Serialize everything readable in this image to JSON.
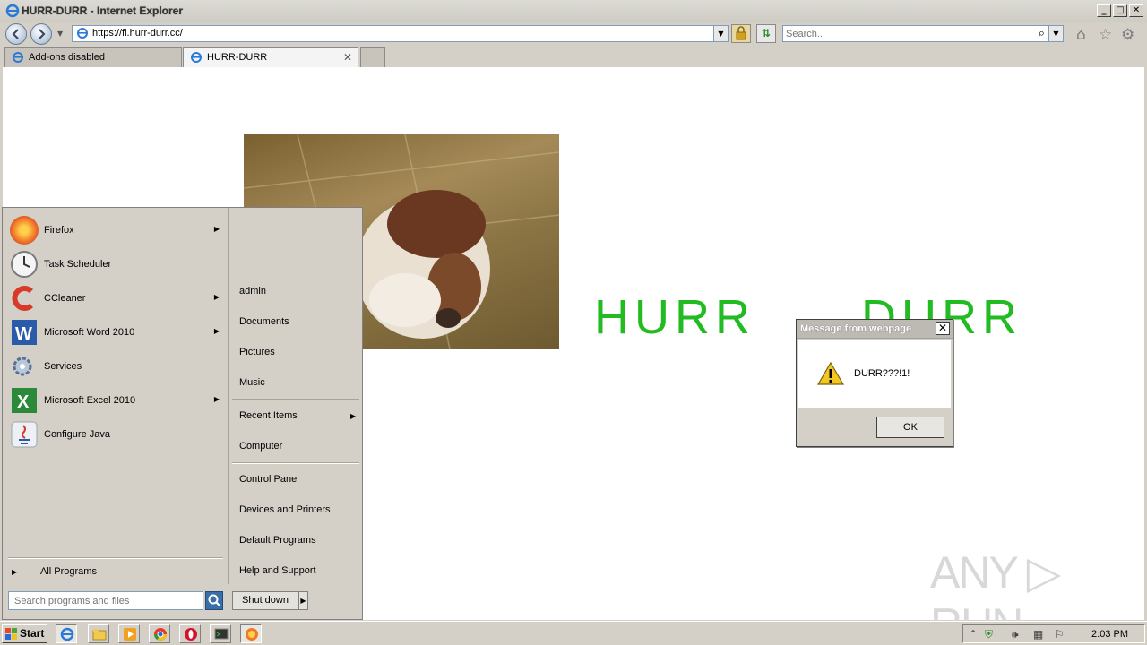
{
  "window": {
    "title": "HURR-DURR - Internet Explorer",
    "min_glyph": "_",
    "max_glyph": "□",
    "close_glyph": "✕"
  },
  "navbar": {
    "url": "https://fl.hurr-durr.cc/",
    "search_placeholder": "Search..."
  },
  "tabs": [
    {
      "label": "Add-ons disabled",
      "active": false
    },
    {
      "label": "HURR-DURR",
      "active": true,
      "close_glyph": "✕"
    }
  ],
  "page": {
    "hurr_text": "HURR",
    "durr_text": "DURR",
    "watermark": "ANY ▷ RUN"
  },
  "dialog": {
    "title": "Message from webpage",
    "message": "DURR???!1!",
    "ok_label": "OK",
    "close_glyph": "✕"
  },
  "start_menu": {
    "programs": [
      {
        "label": "Firefox",
        "icon": "firefox-icon",
        "has_submenu": true,
        "color": "#e8582a"
      },
      {
        "label": "Task Scheduler",
        "icon": "clock-icon",
        "has_submenu": false,
        "color": "#d8d8d8"
      },
      {
        "label": "CCleaner",
        "icon": "ccleaner-icon",
        "has_submenu": true,
        "color": "#d83a2a"
      },
      {
        "label": "Microsoft Word 2010",
        "icon": "word-icon",
        "has_submenu": true,
        "color": "#2a5aa8"
      },
      {
        "label": "Services",
        "icon": "gear-icon",
        "has_submenu": false,
        "color": "#8aa0b8"
      },
      {
        "label": "Microsoft Excel 2010",
        "icon": "excel-icon",
        "has_submenu": true,
        "color": "#2a8a3a"
      },
      {
        "label": "Configure Java",
        "icon": "java-icon",
        "has_submenu": false,
        "color": "#e8e8f0"
      }
    ],
    "all_programs": "All Programs",
    "right_links": {
      "admin": "admin",
      "documents": "Documents",
      "pictures": "Pictures",
      "music": "Music",
      "recent_items": "Recent Items",
      "computer": "Computer",
      "control_panel": "Control Panel",
      "devices_printers": "Devices and Printers",
      "default_programs": "Default Programs",
      "help_support": "Help and Support"
    },
    "search_placeholder": "Search programs and files",
    "shutdown_label": "Shut down"
  },
  "taskbar": {
    "start_label": "Start",
    "clock": "2:03 PM"
  }
}
